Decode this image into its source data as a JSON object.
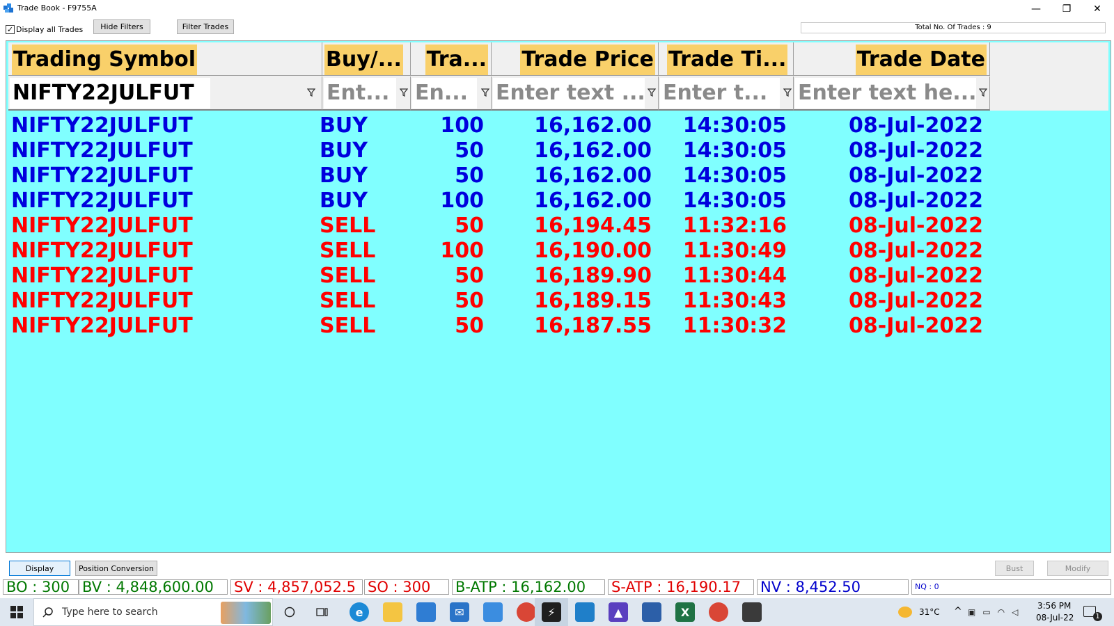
{
  "window": {
    "title": "Trade Book - F9755A",
    "minimize_label": "—",
    "restore_label": "❐",
    "close_label": "✕"
  },
  "toolbar": {
    "display_all_label": "Display all Trades",
    "display_all_checked": "✓",
    "hide_filters_label": "Hide Filters",
    "filter_trades_label": "Filter Trades",
    "total_trades_label": "Total No. Of Trades : 9"
  },
  "grid": {
    "columns": [
      {
        "label": "Trading Symbol"
      },
      {
        "label": "Buy/..."
      },
      {
        "label": "Tra..."
      },
      {
        "label": "Trade Price"
      },
      {
        "label": "Trade Ti..."
      },
      {
        "label": "Trade Date"
      }
    ],
    "filters": [
      {
        "value": "NIFTY22JULFUT",
        "placeholder": ""
      },
      {
        "value": "",
        "placeholder": "Ent..."
      },
      {
        "value": "",
        "placeholder": "En..."
      },
      {
        "value": "",
        "placeholder": "Enter text ..."
      },
      {
        "value": "",
        "placeholder": "Enter t..."
      },
      {
        "value": "",
        "placeholder": "Enter text he..."
      }
    ],
    "rows": [
      {
        "symbol": "NIFTY22JULFUT",
        "side": "BUY",
        "qty": "100",
        "price": "16,162.00",
        "time": "14:30:05",
        "date": "08-Jul-2022"
      },
      {
        "symbol": "NIFTY22JULFUT",
        "side": "BUY",
        "qty": "50",
        "price": "16,162.00",
        "time": "14:30:05",
        "date": "08-Jul-2022"
      },
      {
        "symbol": "NIFTY22JULFUT",
        "side": "BUY",
        "qty": "50",
        "price": "16,162.00",
        "time": "14:30:05",
        "date": "08-Jul-2022"
      },
      {
        "symbol": "NIFTY22JULFUT",
        "side": "BUY",
        "qty": "100",
        "price": "16,162.00",
        "time": "14:30:05",
        "date": "08-Jul-2022"
      },
      {
        "symbol": "NIFTY22JULFUT",
        "side": "SELL",
        "qty": "50",
        "price": "16,194.45",
        "time": "11:32:16",
        "date": "08-Jul-2022"
      },
      {
        "symbol": "NIFTY22JULFUT",
        "side": "SELL",
        "qty": "100",
        "price": "16,190.00",
        "time": "11:30:49",
        "date": "08-Jul-2022"
      },
      {
        "symbol": "NIFTY22JULFUT",
        "side": "SELL",
        "qty": "50",
        "price": "16,189.90",
        "time": "11:30:44",
        "date": "08-Jul-2022"
      },
      {
        "symbol": "NIFTY22JULFUT",
        "side": "SELL",
        "qty": "50",
        "price": "16,189.15",
        "time": "11:30:43",
        "date": "08-Jul-2022"
      },
      {
        "symbol": "NIFTY22JULFUT",
        "side": "SELL",
        "qty": "50",
        "price": "16,187.55",
        "time": "11:30:32",
        "date": "08-Jul-2022"
      }
    ],
    "buy_color": "#0000dd",
    "sell_color": "#ff0000",
    "background_color": "#80ffff",
    "header_highlight_color": "#f9d06a"
  },
  "bottom": {
    "display_label": "Display",
    "position_conversion_label": "Position Conversion",
    "bust_label": "Bust",
    "modify_label": "Modify"
  },
  "status": {
    "bo": "BO : 300",
    "bv": "BV : 4,848,600.00",
    "sv": "SV : 4,857,052.5",
    "so": "SO : 300",
    "batp": "B-ATP : 16,162.00",
    "satp": "S-ATP : 16,190.17",
    "nv": "NV : 8,452.50",
    "nq": "NQ : 0"
  },
  "taskbar": {
    "search_placeholder": "Type here to search",
    "temperature": "31°C",
    "time": "3:56 PM",
    "date": "08-Jul-22",
    "notification_count": "1"
  }
}
